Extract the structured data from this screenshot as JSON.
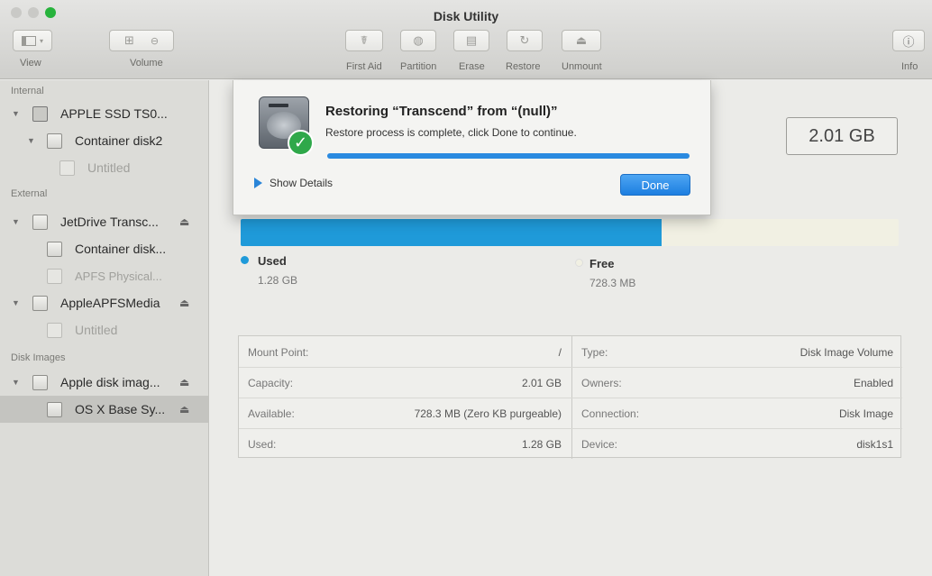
{
  "window": {
    "title": "Disk Utility",
    "traffic_colors": {
      "close": "#c9c9c6",
      "minimize": "#c9c9c6",
      "zoom": "#27b33c"
    }
  },
  "toolbar": {
    "view_label": "View",
    "volume_label": "Volume",
    "first_aid_label": "First Aid",
    "partition_label": "Partition",
    "erase_label": "Erase",
    "restore_label": "Restore",
    "unmount_label": "Unmount",
    "info_label": "Info"
  },
  "sidebar": {
    "sections": {
      "internal": "Internal",
      "external": "External",
      "disk_images": "Disk Images"
    },
    "items": [
      {
        "label": "APPLE SSD TS0...",
        "section": "internal",
        "level": 0,
        "disclosure": "▼",
        "icon": "ssd-icon",
        "dim": false
      },
      {
        "label": "Container disk2",
        "section": "internal",
        "level": 1,
        "disclosure": "▼",
        "icon": "container-icon",
        "dim": false
      },
      {
        "label": "Untitled",
        "section": "internal",
        "level": 2,
        "disclosure": "",
        "icon": "volume-icon",
        "dim": true
      },
      {
        "label": "JetDrive Transc...",
        "section": "external",
        "level": 0,
        "disclosure": "▼",
        "icon": "external-disk-icon",
        "dim": false,
        "eject": "⏏"
      },
      {
        "label": "Container disk...",
        "section": "external",
        "level": 1,
        "disclosure": "",
        "icon": "container-icon",
        "dim": false
      },
      {
        "label": "APFS Physical...",
        "section": "external",
        "level": 1,
        "disclosure": "",
        "icon": "volume-icon",
        "dim": true
      },
      {
        "label": "AppleAPFSMedia",
        "section": "external",
        "level": 0,
        "disclosure": "▼",
        "icon": "external-disk-icon",
        "dim": false,
        "eject": "⏏"
      },
      {
        "label": "Untitled",
        "section": "external",
        "level": 1,
        "disclosure": "",
        "icon": "volume-icon",
        "dim": true
      },
      {
        "label": "Apple disk imag...",
        "section": "disk_images",
        "level": 0,
        "disclosure": "▼",
        "icon": "disk-image-icon",
        "dim": false,
        "eject": "⏏"
      },
      {
        "label": "OS X Base Sy...",
        "section": "disk_images",
        "level": 1,
        "disclosure": "",
        "icon": "volume-icon",
        "dim": false,
        "eject": "⏏",
        "selected": true
      }
    ]
  },
  "main": {
    "capacity_display": "2.01 GB",
    "usage": {
      "used_fraction": 0.64,
      "used_color": "#1f9ad9",
      "free_color": "#f1f0e3",
      "used_title": "Used",
      "used_value": "1.28 GB",
      "free_title": "Free",
      "free_value": "728.3 MB"
    },
    "info": {
      "left": [
        {
          "key": "Mount Point:",
          "value": "/"
        },
        {
          "key": "Capacity:",
          "value": "2.01 GB"
        },
        {
          "key": "Available:",
          "value": "728.3 MB (Zero KB purgeable)"
        },
        {
          "key": "Used:",
          "value": "1.28 GB"
        }
      ],
      "right": [
        {
          "key": "Type:",
          "value": "Disk Image Volume"
        },
        {
          "key": "Owners:",
          "value": "Enabled"
        },
        {
          "key": "Connection:",
          "value": "Disk Image"
        },
        {
          "key": "Device:",
          "value": "disk1s1"
        }
      ]
    }
  },
  "sheet": {
    "title": "Restoring “Transcend” from “(null)”",
    "message": "Restore process is complete, click Done to continue.",
    "progress": 1.0,
    "show_details_label": "Show Details",
    "done_label": "Done",
    "accent_color": "#2a8ae0"
  }
}
